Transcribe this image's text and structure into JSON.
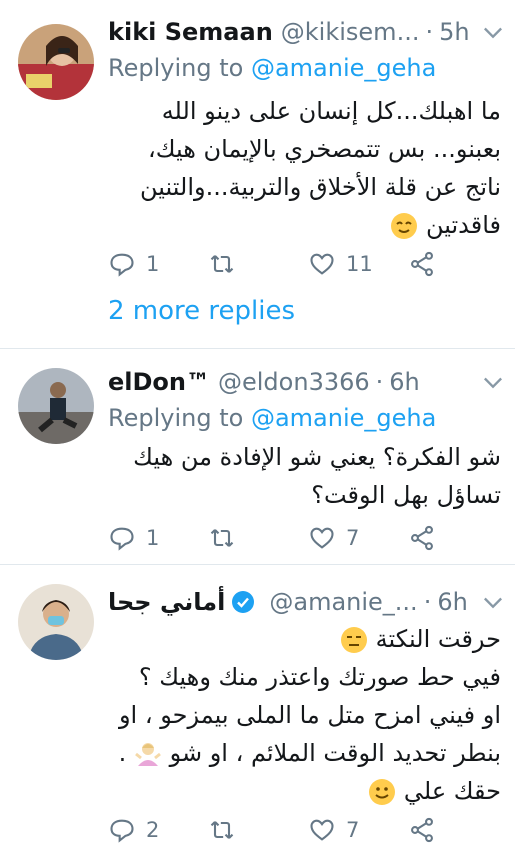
{
  "tweets": [
    {
      "name": "kiki Semaan",
      "handle": "@kikisem...",
      "time": "5h",
      "replying_label": "Replying to",
      "replying_to": "@amanie_geha",
      "lines": [
        "ما اهبلك...كل إنسان على دينو الله",
        "بعبنو... بس تتمصخري بالإيمان هيك،",
        "ناتج عن قلة الأخلاق والتربية...والتنين",
        "فاقدتين"
      ],
      "replies": "1",
      "retweets": "",
      "likes": "11",
      "more_replies": "2 more replies"
    },
    {
      "name": "elDon™",
      "handle": "@eldon3366",
      "time": "6h",
      "replying_label": "Replying to",
      "replying_to": "@amanie_geha",
      "lines": [
        "شو الفكرة؟ يعني شو الإفادة من هيك",
        "تساؤل بهل الوقت؟"
      ],
      "replies": "1",
      "retweets": "",
      "likes": "7"
    },
    {
      "name": "أماني جحا",
      "handle": "@amanie_...",
      "time": "6h",
      "lines": [
        "حرقت النكتة",
        "فيي حط صورتك واعتذر منك وهيك ؟",
        "او فيني امزح متل ما الملى بيمزحو ، او",
        "بنطر تحديد الوقت الملائم ، او شو",
        "حقك علي"
      ],
      "replies": "2",
      "retweets": "",
      "likes": "7"
    }
  ],
  "colors": {
    "link": "#1da1f2",
    "muted": "#657786",
    "text": "#14171a",
    "divider": "#e1e8ed"
  }
}
